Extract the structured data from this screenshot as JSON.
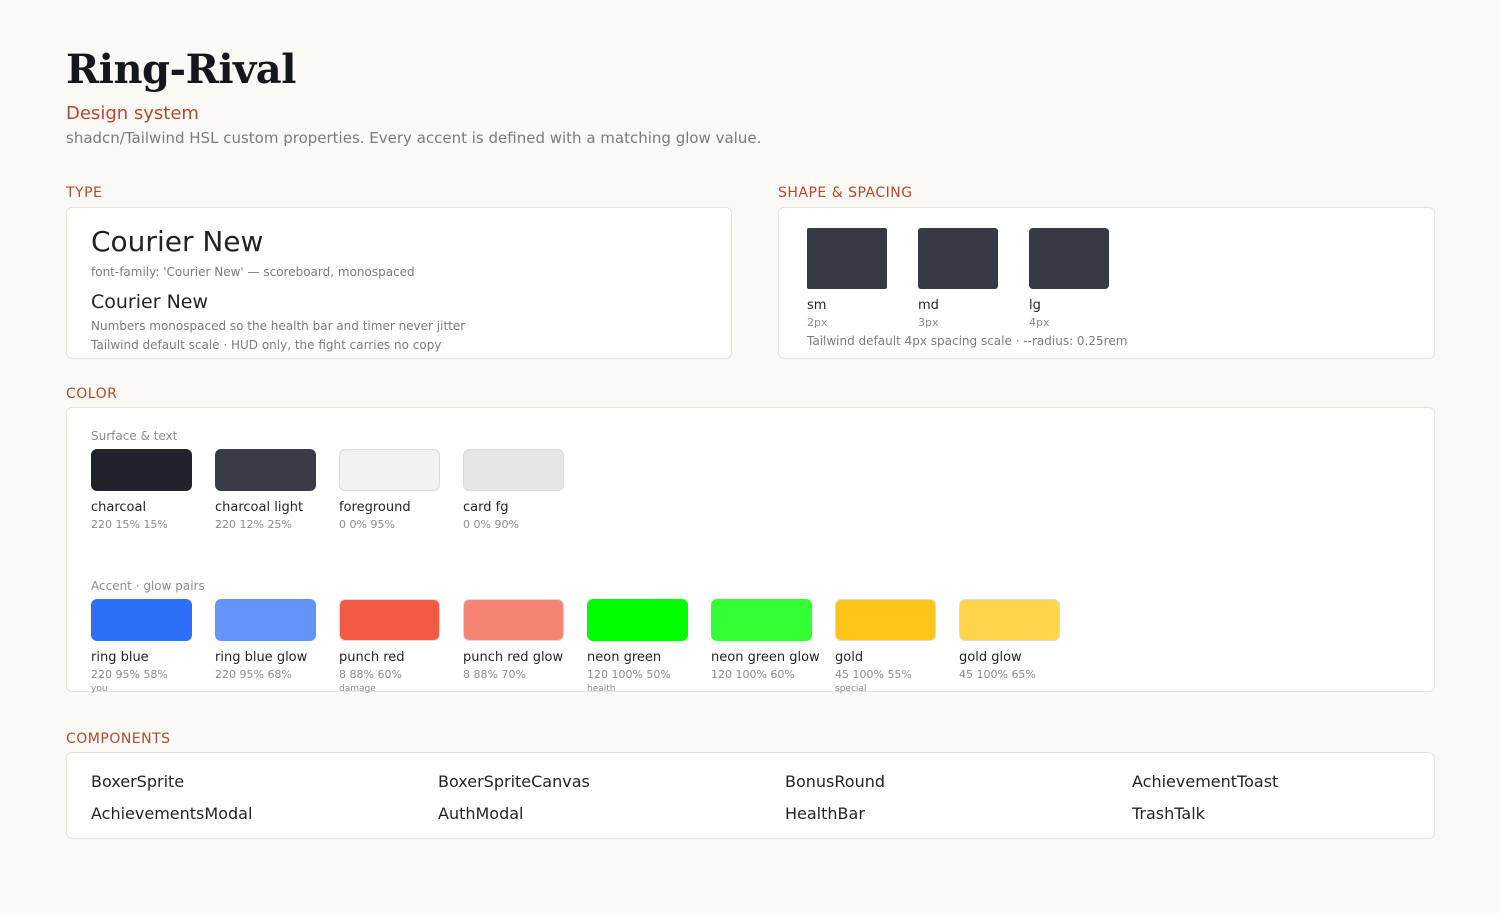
{
  "header": {
    "title": "Ring-Rival",
    "subtitle": "Design system",
    "description": "shadcn/Tailwind HSL custom properties. Every accent is defined with a matching glow value."
  },
  "sections": {
    "type": "TYPE",
    "shape": "SHAPE & SPACING",
    "color": "COLOR",
    "components": "COMPONENTS"
  },
  "type_card": {
    "display_name": "Courier New",
    "display_note": "font-family: 'Courier New' — scoreboard, monospaced",
    "body_name": "Courier New",
    "body_note": "Numbers monospaced so the health bar and timer never jitter",
    "scale_note": "Tailwind default scale · HUD only, the fight carries no copy"
  },
  "shape_card": {
    "radii": [
      {
        "name": "sm",
        "value": "2px"
      },
      {
        "name": "md",
        "value": "3px"
      },
      {
        "name": "lg",
        "value": "4px"
      }
    ],
    "note": "Tailwind default 4px spacing scale  ·  --radius: 0.25rem"
  },
  "color_card": {
    "surface_label": "Surface & text",
    "surface": [
      {
        "name": "charcoal",
        "hsl": "220 15% 15%",
        "hex": "#20232b"
      },
      {
        "name": "charcoal light",
        "hsl": "220 12% 25%",
        "hex": "#383c47"
      },
      {
        "name": "foreground",
        "hsl": "0 0% 95%",
        "hex": "#f2f2f2"
      },
      {
        "name": "card fg",
        "hsl": "0 0% 90%",
        "hex": "#e6e6e6"
      }
    ],
    "accent_label": "Accent · glow pairs",
    "accent": [
      {
        "name": "ring blue",
        "hsl": "220 95% 58%",
        "note": "you",
        "hex": "#2f70f9"
      },
      {
        "name": "ring blue glow",
        "hsl": "220 95% 68%",
        "hex": "#6294fa"
      },
      {
        "name": "punch red",
        "hsl": "8 88% 60%",
        "note": "damage",
        "hex": "#f25a43"
      },
      {
        "name": "punch red glow",
        "hsl": "8 88% 70%",
        "hex": "#f58573"
      },
      {
        "name": "neon green",
        "hsl": "120 100% 50%",
        "note": "health",
        "hex": "#00ff00"
      },
      {
        "name": "neon green glow",
        "hsl": "120 100% 60%",
        "hex": "#33ff33"
      },
      {
        "name": "gold",
        "hsl": "45 100% 55%",
        "note": "special",
        "hex": "#ffc61a"
      },
      {
        "name": "gold glow",
        "hsl": "45 100% 65%",
        "hex": "#ffd54d"
      }
    ]
  },
  "components": [
    "BoxerSprite",
    "BoxerSpriteCanvas",
    "BonusRound",
    "AchievementToast",
    "AchievementsModal",
    "AuthModal",
    "HealthBar",
    "TrashTalk"
  ]
}
